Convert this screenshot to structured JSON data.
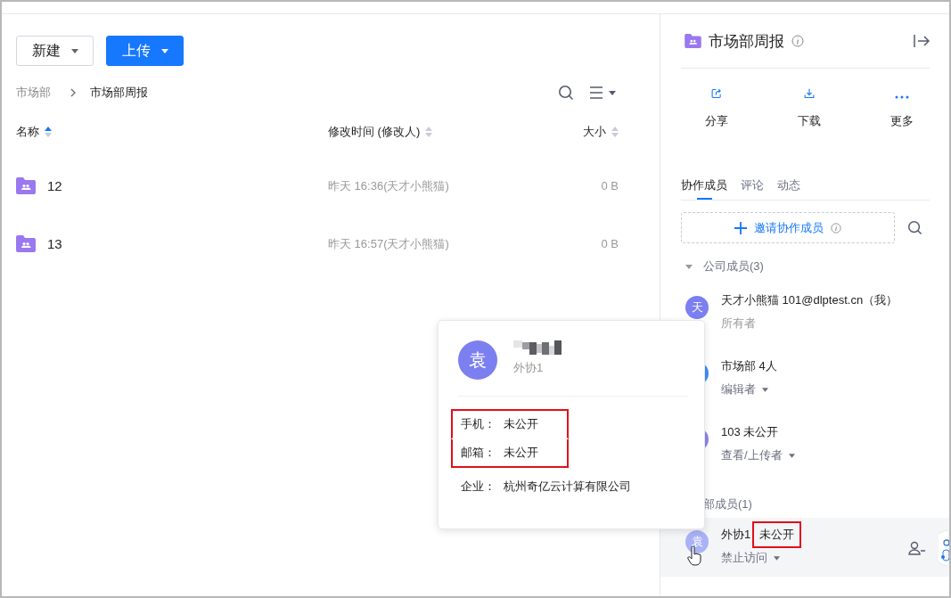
{
  "toolbar": {
    "buttons": [
      {
        "label": "新建",
        "kind": "outline"
      },
      {
        "label": "上传",
        "kind": "primary"
      }
    ]
  },
  "breadcrumb": [
    "市场部",
    "市场部周报"
  ],
  "table": {
    "columns": [
      {
        "label": "名称",
        "sorted": true
      },
      {
        "label": "修改时间 (修改人)",
        "sorted": false
      },
      {
        "label": "大小",
        "sorted": false
      }
    ],
    "rows": [
      {
        "name": "12",
        "modified": "昨天 16:36(天才小熊猫)",
        "size": "0 B"
      },
      {
        "name": "13",
        "modified": "昨天 16:57(天才小熊猫)",
        "size": "0 B"
      }
    ]
  },
  "panel": {
    "title": "市场部周报",
    "actions": [
      {
        "label": "分享",
        "kind": "share"
      },
      {
        "label": "下载",
        "kind": "download"
      },
      {
        "label": "更多",
        "kind": "more"
      }
    ],
    "tabs": [
      {
        "label": "协作成员",
        "selected": true
      },
      {
        "label": "评论",
        "selected": false
      },
      {
        "label": "动态",
        "selected": false
      }
    ],
    "invite_button": "邀请协作成员",
    "groups": [
      {
        "label": "公司成员(3)",
        "expanded": true,
        "members": [
          {
            "avatar": "天",
            "color": "#7b7ff0",
            "name": "天才小熊猫 101@dlptest.cn（我）",
            "role": "所有者",
            "role_menu": false,
            "hovered": false
          },
          {
            "color": "#3e8ef7",
            "name": "市场部 4人",
            "role": "编辑者",
            "role_menu": true,
            "hovered": false
          },
          {
            "color": "#8b86f0",
            "name": "103 未公开",
            "role": "查看/上传者",
            "role_menu": true,
            "hovered": false
          }
        ]
      },
      {
        "label": "部成员(1)",
        "members": [
          {
            "avatar": "袁",
            "color": "#a9b2f6",
            "name": "外协1",
            "tag": "未公开",
            "tag_highlighted": true,
            "role": "禁止访问",
            "role_menu": true,
            "hovered": true
          }
        ]
      }
    ]
  },
  "popover": {
    "avatar": "袁",
    "subtitle": "外协1",
    "fields": [
      {
        "label": "手机：",
        "value": "未公开",
        "highlighted": true
      },
      {
        "label": "邮箱：",
        "value": "未公开",
        "highlighted": true
      },
      {
        "label": "企业：",
        "value": "杭州奇亿云计算有限公司",
        "highlighted": false
      }
    ]
  }
}
